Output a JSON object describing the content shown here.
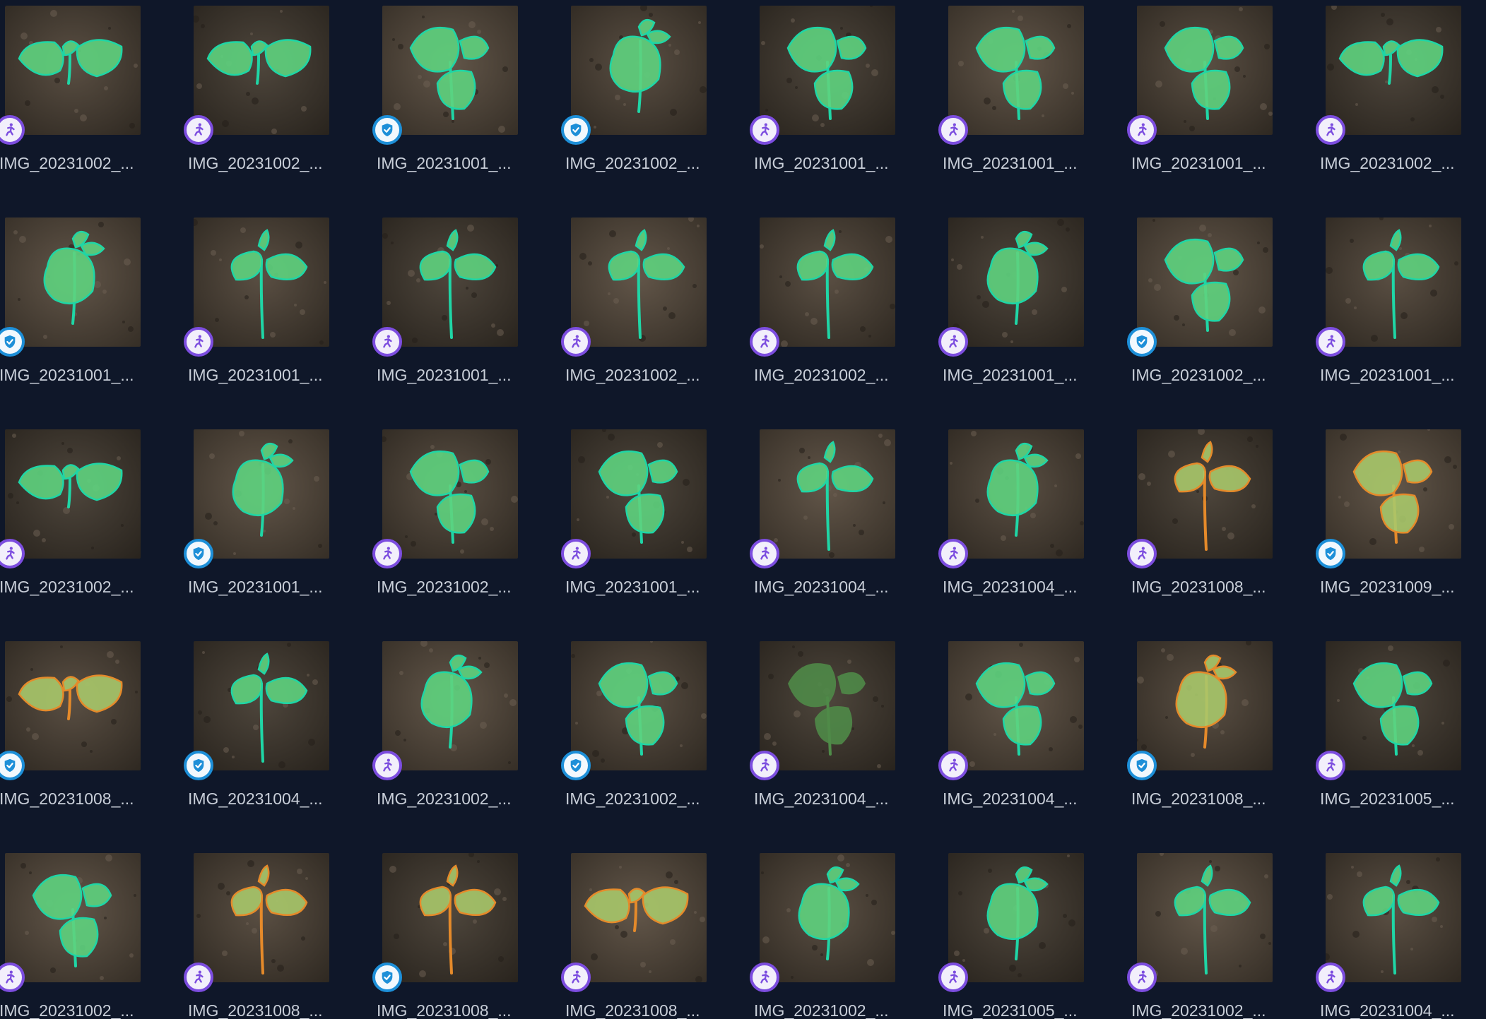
{
  "gallery": {
    "items": [
      {
        "filename": "IMG_20231002_...",
        "status": "annotate",
        "variant": 1,
        "tone": "green"
      },
      {
        "filename": "IMG_20231002_...",
        "status": "annotate",
        "variant": 1,
        "tone": "green"
      },
      {
        "filename": "IMG_20231001_...",
        "status": "verified",
        "variant": 2,
        "tone": "green"
      },
      {
        "filename": "IMG_20231002_...",
        "status": "verified",
        "variant": 3,
        "tone": "green"
      },
      {
        "filename": "IMG_20231001_...",
        "status": "annotate",
        "variant": 2,
        "tone": "green"
      },
      {
        "filename": "IMG_20231001_...",
        "status": "annotate",
        "variant": 2,
        "tone": "green"
      },
      {
        "filename": "IMG_20231001_...",
        "status": "annotate",
        "variant": 2,
        "tone": "green"
      },
      {
        "filename": "IMG_20231002_...",
        "status": "annotate",
        "variant": 1,
        "tone": "green"
      },
      {
        "filename": "IMG_20231001_...",
        "status": "verified",
        "variant": 3,
        "tone": "green"
      },
      {
        "filename": "IMG_20231001_...",
        "status": "annotate",
        "variant": 0,
        "tone": "green"
      },
      {
        "filename": "IMG_20231001_...",
        "status": "annotate",
        "variant": 0,
        "tone": "green"
      },
      {
        "filename": "IMG_20231002_...",
        "status": "annotate",
        "variant": 0,
        "tone": "green"
      },
      {
        "filename": "IMG_20231002_...",
        "status": "annotate",
        "variant": 0,
        "tone": "green"
      },
      {
        "filename": "IMG_20231001_...",
        "status": "annotate",
        "variant": 3,
        "tone": "green"
      },
      {
        "filename": "IMG_20231002_...",
        "status": "verified",
        "variant": 2,
        "tone": "green"
      },
      {
        "filename": "IMG_20231001_...",
        "status": "annotate",
        "variant": 0,
        "tone": "green"
      },
      {
        "filename": "IMG_20231002_...",
        "status": "annotate",
        "variant": 1,
        "tone": "green"
      },
      {
        "filename": "IMG_20231001_...",
        "status": "verified",
        "variant": 3,
        "tone": "green"
      },
      {
        "filename": "IMG_20231002_...",
        "status": "annotate",
        "variant": 2,
        "tone": "green"
      },
      {
        "filename": "IMG_20231001_...",
        "status": "annotate",
        "variant": 2,
        "tone": "green"
      },
      {
        "filename": "IMG_20231004_...",
        "status": "annotate",
        "variant": 0,
        "tone": "green"
      },
      {
        "filename": "IMG_20231004_...",
        "status": "annotate",
        "variant": 3,
        "tone": "green"
      },
      {
        "filename": "IMG_20231008_...",
        "status": "annotate",
        "variant": 0,
        "tone": "orange"
      },
      {
        "filename": "IMG_20231009_...",
        "status": "verified",
        "variant": 2,
        "tone": "orange"
      },
      {
        "filename": "IMG_20231008_...",
        "status": "verified",
        "variant": 1,
        "tone": "orange"
      },
      {
        "filename": "IMG_20231004_...",
        "status": "verified",
        "variant": 0,
        "tone": "green"
      },
      {
        "filename": "IMG_20231002_...",
        "status": "annotate",
        "variant": 3,
        "tone": "green"
      },
      {
        "filename": "IMG_20231002_...",
        "status": "verified",
        "variant": 2,
        "tone": "green"
      },
      {
        "filename": "IMG_20231004_...",
        "status": "annotate",
        "variant": 2,
        "tone": "plain"
      },
      {
        "filename": "IMG_20231004_...",
        "status": "annotate",
        "variant": 2,
        "tone": "green"
      },
      {
        "filename": "IMG_20231008_...",
        "status": "verified",
        "variant": 3,
        "tone": "orange"
      },
      {
        "filename": "IMG_20231005_...",
        "status": "annotate",
        "variant": 2,
        "tone": "green"
      },
      {
        "filename": "IMG_20231002_...",
        "status": "annotate",
        "variant": 2,
        "tone": "green"
      },
      {
        "filename": "IMG_20231008_...",
        "status": "annotate",
        "variant": 0,
        "tone": "orange"
      },
      {
        "filename": "IMG_20231008_...",
        "status": "verified",
        "variant": 0,
        "tone": "orange"
      },
      {
        "filename": "IMG_20231008_...",
        "status": "annotate",
        "variant": 1,
        "tone": "orange"
      },
      {
        "filename": "IMG_20231002_...",
        "status": "annotate",
        "variant": 3,
        "tone": "green"
      },
      {
        "filename": "IMG_20231005_...",
        "status": "annotate",
        "variant": 3,
        "tone": "green"
      },
      {
        "filename": "IMG_20231002_...",
        "status": "annotate",
        "variant": 0,
        "tone": "green"
      },
      {
        "filename": "IMG_20231004_...",
        "status": "annotate",
        "variant": 0,
        "tone": "green"
      }
    ]
  },
  "colors": {
    "background": "#0f1729",
    "annotate_badge": "#7c4ddf",
    "verified_badge": "#1d8fd8",
    "mask_green": "#5ed37e",
    "mask_outline": "#1fd6a6",
    "mask_orange_outline": "#e58a2a",
    "filename_text": "#c8ced8"
  },
  "icons": {
    "annotate": "running-person-icon",
    "verified": "shield-check-icon"
  }
}
